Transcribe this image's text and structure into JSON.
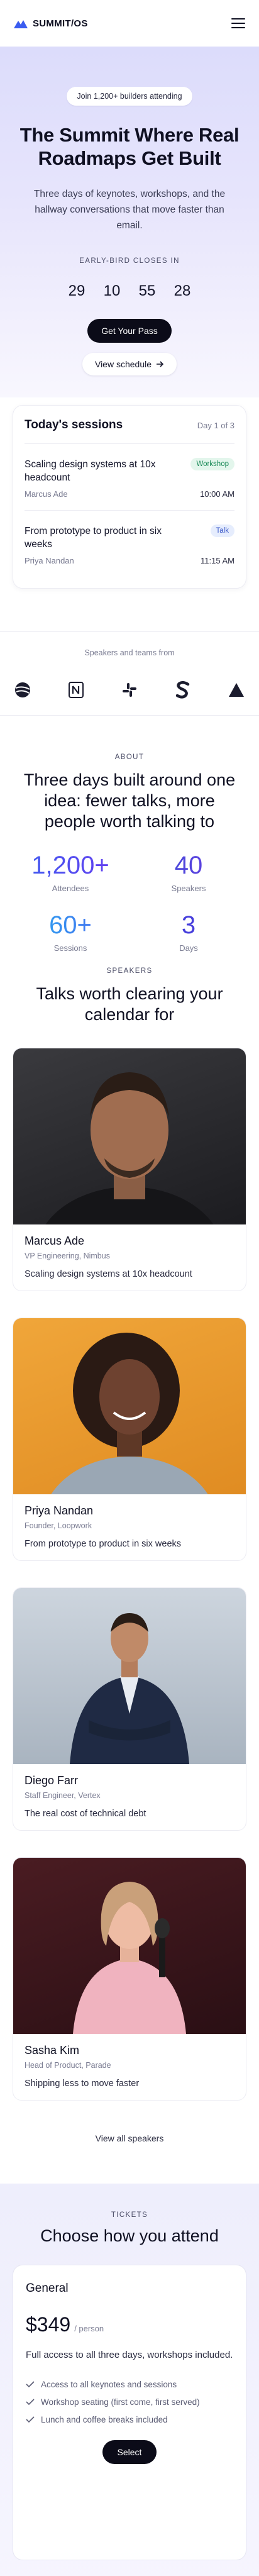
{
  "brand": {
    "name": "SUMMIT/OS"
  },
  "hero": {
    "badge": "Join 1,200+ builders attending",
    "title": "The Summit Where Real Roadmaps Get Built",
    "subtitle": "Three days of keynotes, workshops, and the hallway conversations that move faster than email.",
    "countdown_label": "EARLY-BIRD CLOSES IN",
    "countdown": [
      "29",
      "10",
      "55",
      "28"
    ],
    "primary_cta": "Get Your Pass",
    "secondary_cta": "View schedule"
  },
  "sessions": {
    "title": "Today's sessions",
    "day": "Day 1 of 3",
    "items": [
      {
        "title": "Scaling design systems at 10x headcount",
        "speaker": "Marcus Ade",
        "tag": "Workshop",
        "time": "10:00 AM"
      },
      {
        "title": "From prototype to product in six weeks",
        "speaker": "Priya Nandan",
        "tag": "Talk",
        "time": "11:15 AM"
      }
    ]
  },
  "logos": {
    "label": "Speakers and teams from",
    "items": [
      "globe-logo",
      "notion-logo",
      "slack-logo",
      "stripe-logo",
      "triangle-logo"
    ]
  },
  "about": {
    "kicker": "ABOUT",
    "title": "Three days built around one idea: fewer talks, more people worth talking to",
    "stats": [
      {
        "value": "1,200+",
        "label": "Attendees"
      },
      {
        "value": "40",
        "label": "Speakers"
      },
      {
        "value": "60+",
        "label": "Sessions"
      },
      {
        "value": "3",
        "label": "Days"
      }
    ]
  },
  "speakers": {
    "kicker": "SPEAKERS",
    "title": "Talks worth clearing your calendar for",
    "items": [
      {
        "name": "Marcus Ade",
        "role": "VP Engineering, Nimbus",
        "talk": "Scaling design systems at 10x headcount"
      },
      {
        "name": "Priya Nandan",
        "role": "Founder, Loopwork",
        "talk": "From prototype to product in six weeks"
      },
      {
        "name": "Diego Farr",
        "role": "Staff Engineer, Vertex",
        "talk": "The real cost of technical debt"
      },
      {
        "name": "Sasha Kim",
        "role": "Head of Product, Parade",
        "talk": "Shipping less to move faster"
      }
    ],
    "view_all": "View all speakers"
  },
  "tickets": {
    "kicker": "TICKETS",
    "title": "Choose how you attend",
    "plan": {
      "name": "General",
      "price": "$349",
      "per": "/ person",
      "description": "Full access to all three days, workshops included.",
      "features": [
        "Access to all keynotes and sessions",
        "Workshop seating (first come, first served)",
        "Lunch and coffee breaks included"
      ],
      "cta": "Select"
    }
  },
  "colors": {
    "accent": "#3a5cf0",
    "dark": "#0b0b18",
    "workshop_tag": "#1a8a57",
    "talk_tag": "#3856c8"
  }
}
